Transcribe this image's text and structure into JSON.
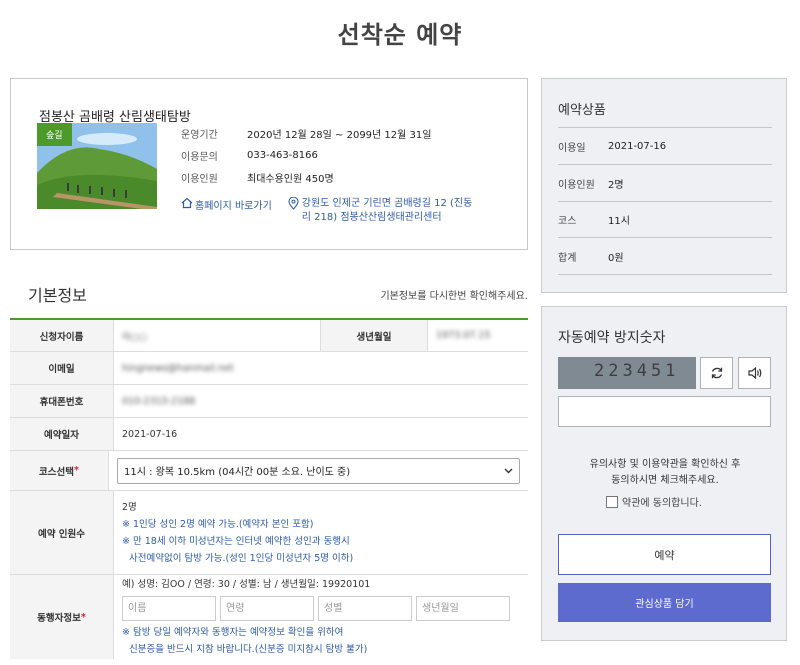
{
  "page_title": "선착순 예약",
  "facility": {
    "name": "점봉산 곰배령 산림생태탐방",
    "tag": "숲길",
    "info": [
      {
        "label": "운영기간",
        "value": "2020년 12월 28일 ~ 2099년 12월 31일"
      },
      {
        "label": "이용문의",
        "value": "033-463-8166"
      },
      {
        "label": "이용인원",
        "value": "최대수용인원 450명"
      }
    ],
    "homepage_link": "홈페이지 바로가기",
    "address": "강원도 인제군 기린면 곰배령길 12 (진동리 218) 점봉산산림생태관리센터"
  },
  "basic_info": {
    "title": "기본정보",
    "note": "기본정보를 다시한번 확인해주세요.",
    "applicant_label": "신청자이름",
    "applicant_value": "이○○",
    "birth_label": "생년월일",
    "birth_value": "1973.07.15",
    "email_label": "이메일",
    "email_value": "hingnews@hanmail.net",
    "phone_label": "휴대폰번호",
    "phone_value": "010-2315-2188",
    "date_label": "예약일자",
    "date_value": "2021-07-16",
    "course_label": "코스선택",
    "course_required": "*",
    "course_value": "11시 : 왕복 10.5km (04시간 00분 소요. 난이도 중)",
    "people_label": "예약 인원수",
    "people_value": "2명",
    "people_note1": "※ 1인당 성인 2명 예약 가능.(예약자 본인 포함)",
    "people_note2": "※ 만 18세 이하 미성년자는 인터넷 예약한 성인과 동행시",
    "people_note3": "사전예약없이 탐방 가능.(성인 1인당 미성년자 5명 이하)",
    "companion_label": "동행자정보",
    "companion_required": "*",
    "companion_example": "예) 성명: 김OO / 연령: 30 / 성별: 남 / 생년월일: 19920101",
    "companion_placeholders": [
      "이름",
      "연령",
      "성별",
      "생년월일"
    ],
    "companion_note1": "※ 탐방 당일 예약자와 동행자는 예약정보 확인을 위하여",
    "companion_note2": "신분증을 반드시 지참 바랍니다.(신분증 미지참시 탐방 불가)"
  },
  "summary": {
    "title": "예약상품",
    "rows": [
      {
        "label": "이용일",
        "value": "2021-07-16"
      },
      {
        "label": "이용인원",
        "value": "2명"
      },
      {
        "label": "코스",
        "value": "11시"
      },
      {
        "label": "합계",
        "value": "0원"
      }
    ]
  },
  "captcha": {
    "title": "자동예약 방지숫자",
    "code": "223451",
    "agree_text_1": "유의사항 및 이용약관을 확인하신 후",
    "agree_text_2": "동의하시면 체크해주세요.",
    "agree_label": "약관에 동의합니다.",
    "reserve_button": "예약",
    "wishlist_button": "관심상품 담기"
  },
  "colors": {
    "accent_green": "#4c9a2a",
    "accent_blue": "#5d6bcf",
    "link_blue": "#2e5aa6"
  }
}
